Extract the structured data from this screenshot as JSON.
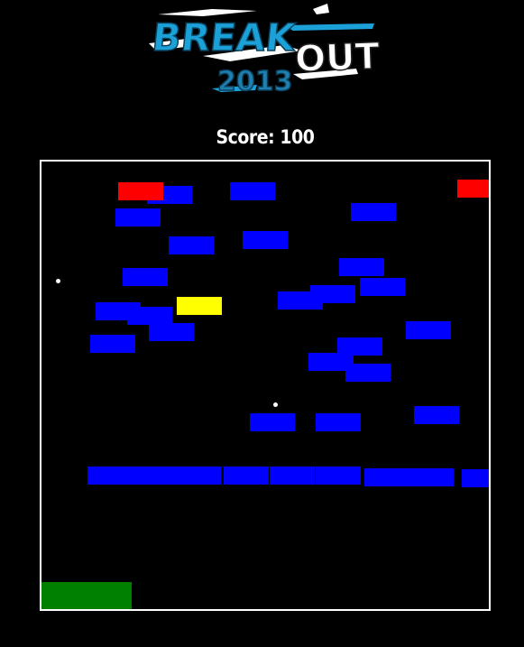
{
  "logo": {
    "line1": "BREAK",
    "line2": "OUT",
    "year": "2013",
    "colors": {
      "blue": "#1ba1d8",
      "dark_blue": "#0e6f9a",
      "white": "#ffffff"
    }
  },
  "score": {
    "label": "Score: 100",
    "value": 100
  },
  "game": {
    "colors": {
      "brick": "#0000ff",
      "brick_red": "#ff0000",
      "brick_yellow": "#ffff00",
      "paddle": "#008000",
      "ball": "#ffffff",
      "border": "#ffffff",
      "background": "#000000"
    },
    "brick_count": {
      "blue": 39,
      "red": 2,
      "yellow": 1
    },
    "ball_count": 2,
    "paddle_count": 1
  }
}
